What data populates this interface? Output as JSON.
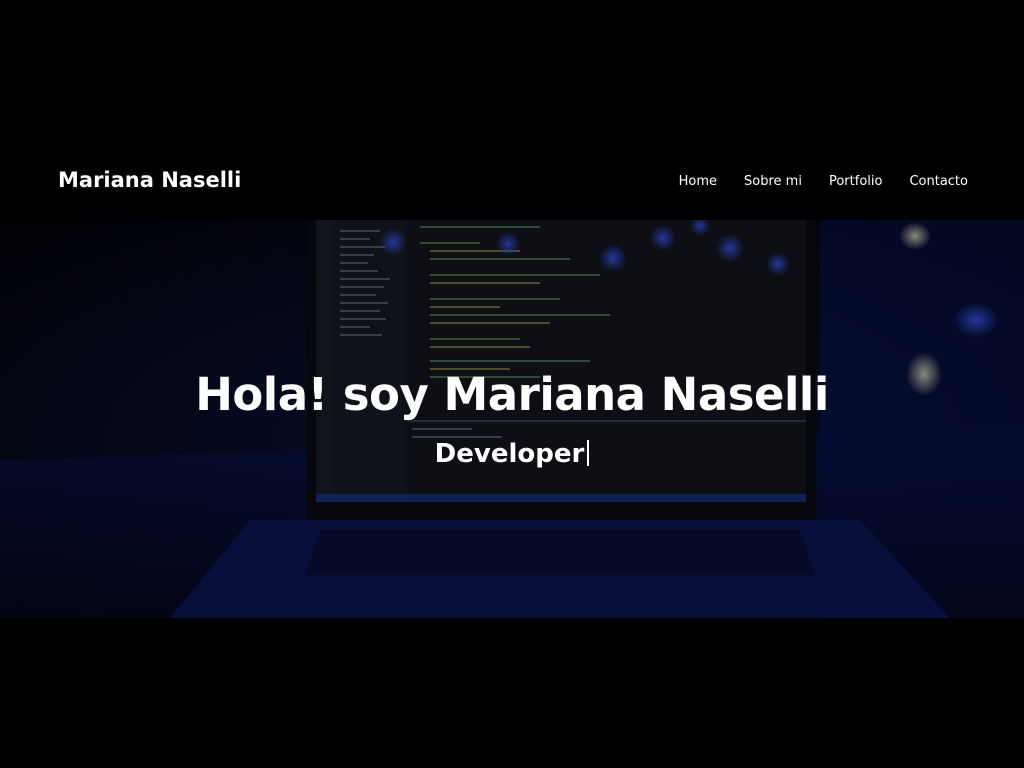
{
  "header": {
    "brand": "Mariana Naselli",
    "nav": [
      {
        "label": "Home"
      },
      {
        "label": "Sobre mi"
      },
      {
        "label": "Portfolio"
      },
      {
        "label": "Contacto"
      }
    ]
  },
  "hero": {
    "title": "Hola! soy Mariana Naselli",
    "typed_text": "Developer",
    "background_image": "laptop-code-editor-night"
  },
  "colors": {
    "background": "#000000",
    "text": "#ffffff",
    "hero_tint": "#0a1a6b"
  }
}
